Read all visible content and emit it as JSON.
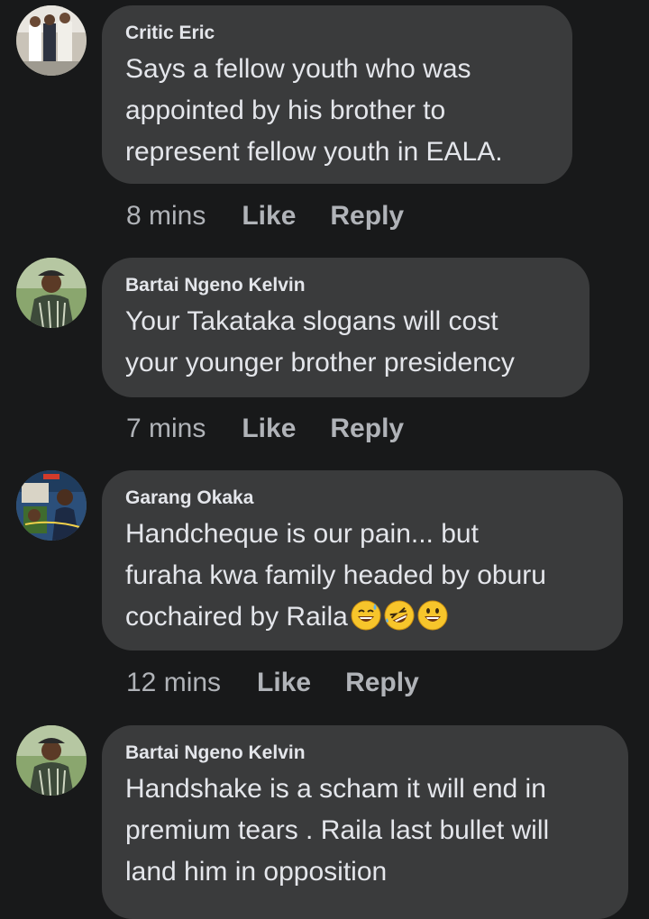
{
  "comments": [
    {
      "author": "Critic Eric",
      "text": "Says a fellow youth who was\nappointed by his brother to\nrepresent fellow youth in EALA.",
      "time": "8 mins",
      "like": "Like",
      "reply": "Reply"
    },
    {
      "author": "Bartai Ngeno Kelvin",
      "text": "Your Takataka slogans will cost\nyour younger brother presidency",
      "time": "7 mins",
      "like": "Like",
      "reply": "Reply"
    },
    {
      "author": "Garang Okaka",
      "text": "Handcheque is our pain... but\nfuraha kwa family headed by oburu\ncochaired by Raila",
      "emojis": [
        "grinning-sweat-emoji",
        "rolling-on-floor-laughing-emoji",
        "grinning-emoji"
      ],
      "time": "12 mins",
      "like": "Like",
      "reply": "Reply"
    },
    {
      "author": "Bartai Ngeno Kelvin",
      "text": "Handshake is a scham it will end in\npremium tears . Raila last bullet will\nland him in opposition",
      "time": "",
      "like": "",
      "reply": ""
    }
  ],
  "colors": {
    "background": "#18191a",
    "bubble": "#3a3b3c",
    "text": "#e4e6eb",
    "secondary": "#b0b3b8",
    "emoji": "#f7c52b"
  }
}
